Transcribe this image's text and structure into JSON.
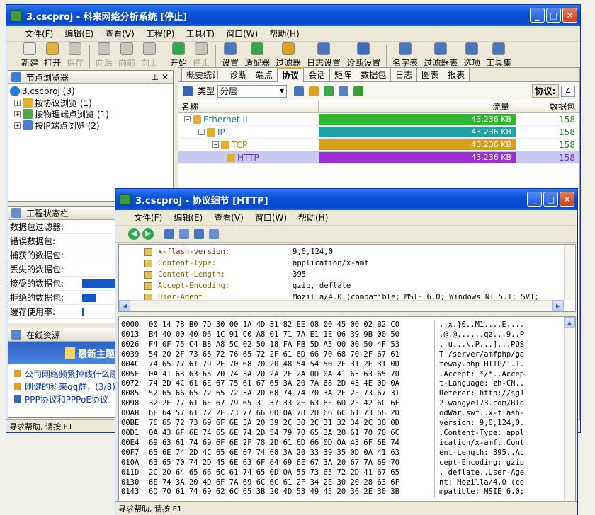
{
  "main": {
    "title": "3.cscproj - 科来网络分析系统 [停止]",
    "menu": [
      "文件(F)",
      "编辑(E)",
      "查看(V)",
      "工程(P)",
      "工具(T)",
      "窗口(W)",
      "帮助(H)"
    ],
    "toolbar": [
      "新建",
      "打开",
      "保存",
      "向后",
      "向前",
      "向上",
      "开始",
      "停止",
      "设置",
      "适配器",
      "过滤器",
      "日志设置",
      "诊断设置",
      "名字表",
      "过滤器表",
      "选项",
      "工具集"
    ],
    "disabled": [
      "保存",
      "向后",
      "向前",
      "向上",
      "停止"
    ],
    "status": "寻求帮助, 请按 F1"
  },
  "nav": {
    "title": "节点浏览器",
    "root": "3.cscproj (3)",
    "items": [
      "按协议浏览 (1)",
      "按物理端点浏览 (1)",
      "按IP端点浏览 (2)"
    ]
  },
  "proj": {
    "title": "工程状态栏",
    "rows": [
      "数据包过滤器:",
      "错误数据包:",
      "捕获的数据包:",
      "丢失的数据包:",
      "接受的数据包:",
      "拒绝的数据包:",
      "缓存使用率:"
    ],
    "bars": [
      0,
      0,
      0,
      0,
      0.6,
      0.25,
      0.02
    ]
  },
  "online": {
    "title": "在线资源",
    "banner": "最新主题",
    "items": [
      "公司网络频繁掉线什么原",
      "刚健的科来qq群，(3/8)",
      "PPP协议和PPPoE协议"
    ]
  },
  "right": {
    "tabs": [
      "概要统计",
      "诊断",
      "端点",
      "协议",
      "会话",
      "矩阵",
      "数据包",
      "日志",
      "图表",
      "报表"
    ],
    "active": "协议",
    "type_label": "类型",
    "type_value": "分层",
    "proto_label": "协议:",
    "proto_count": "4",
    "columns": [
      "名称",
      "流量",
      "数据包"
    ],
    "rows": [
      {
        "name": "Ethernet II",
        "traffic": "43.236 KB",
        "packets": "158",
        "color": "#2eb82e",
        "indent": 0
      },
      {
        "name": "IP",
        "traffic": "43.236 KB",
        "packets": "158",
        "color": "#1fa3a3",
        "indent": 1
      },
      {
        "name": "TCP",
        "traffic": "43.236 KB",
        "packets": "158",
        "color": "#d4a017",
        "indent": 2
      },
      {
        "name": "HTTP",
        "traffic": "43.236 KB",
        "packets": "158",
        "color": "#9b30d6",
        "indent": 3
      }
    ]
  },
  "detail": {
    "title": "3.cscproj - 协议细节 [HTTP]",
    "menu": [
      "文件(F)",
      "编辑(E)",
      "查看(V)",
      "窗口(W)",
      "帮助(H)"
    ],
    "fields": [
      {
        "k": "x-flash-version:",
        "v": "9,0,124,0"
      },
      {
        "k": "Content-Type:",
        "v": "application/x-amf"
      },
      {
        "k": "Content-Length:",
        "v": "395"
      },
      {
        "k": "Accept-Encoding:",
        "v": "gzip, deflate"
      },
      {
        "k": "User-Agent:",
        "v": "Mozilla/4.0 (compatible; MSIE 6.0; Windows NT 5.1; SV1;"
      }
    ],
    "offsets": [
      "0000",
      "0013",
      "0026",
      "0039",
      "004C",
      "005F",
      "0072",
      "0085",
      "0098",
      "00AB",
      "00BE",
      "00D1",
      "00E4",
      "00F7",
      "010A",
      "011D",
      "0130",
      "0143"
    ],
    "hex": [
      "00 14 78 B0 7D 30 00 1A 4D 31 82 EE 08 00 45 00 02 B2 C0",
      "B4 40 00 40 06 1C 91 C0 A8 01 71 7A E1 1E 06 39 9B 00 50",
      "F4 0F 75 C4 B8 A8 5C 02 50 18 FA FB 5D A5 00 00 50 4F 53",
      "54 20 2F 73 65 72 76 65 72 2F 61 6D 66 70 68 70 2F 67 61",
      "74 65 77 61 79 2E 70 68 70 20 48 54 54 50 2F 31 2E 31 0D",
      "0A 41 63 63 65 70 74 3A 20 2A 2F 2A 0D 0A 41 63 63 65 70",
      "74 2D 4C 61 6E 67 75 61 67 65 3A 20 7A 68 2D 43 4E 0D 0A",
      "52 65 66 65 72 65 72 3A 20 68 74 74 70 3A 2F 2F 73 67 31",
      "32 2E 77 61 6E 67 79 65 31 37 33 2E 63 6F 6D 2F 42 6C 6F",
      "6F 64 57 61 72 2E 73 77 66 0D 0A 78 2D 66 6C 61 73 68 2D",
      "76 65 72 73 69 6F 6E 3A 20 39 2C 30 2C 31 32 34 2C 30 0D",
      "0A 43 6F 6E 74 65 6E 74 2D 54 79 70 65 3A 20 61 70 70 6C",
      "69 63 61 74 69 6F 6E 2F 78 2D 61 6D 66 0D 0A 43 6F 6E 74",
      "65 6E 74 2D 4C 65 6E 67 74 68 3A 20 33 39 35 0D 0A 41 63",
      "63 65 70 74 2D 45 6E 63 6F 64 69 6E 67 3A 20 67 7A 69 70",
      "2C 20 64 65 66 6C 61 74 65 0D 0A 55 73 65 72 2D 41 67 65",
      "6E 74 3A 20 4D 6F 7A 69 6C 6C 61 2F 34 2E 30 20 28 63 6F",
      "6D 70 61 74 69 62 6C 65 3B 20 4D 53 49 45 20 36 2E 30 3B"
    ],
    "ascii": [
      "..x.}0..M1....E....",
      ".@.@......qz...9..P",
      "..u...\\.P...]...POS",
      "T /server/amfphp/ga",
      "teway.php HTTP/1.1.",
      ".Accept: */*..Accep",
      "t-Language: zh-CN..",
      "Referer: http://sg1",
      "2.wangye173.com/Blo",
      "odWar.swf..x-flash-",
      "version: 9,0,124,0.",
      ".Content-Type: appl",
      "ication/x-amf..Cont",
      "ent-Length: 395..Ac",
      "cept-Encoding: gzip",
      ", deflate..User-Age",
      "nt: Mozilla/4.0 (co",
      "mpatible; MSIE 6.0;"
    ],
    "status": "寻求帮助, 请按 F1"
  },
  "colors": {
    "accent": "#0a52d6",
    "selected": "#c7c9f0"
  }
}
